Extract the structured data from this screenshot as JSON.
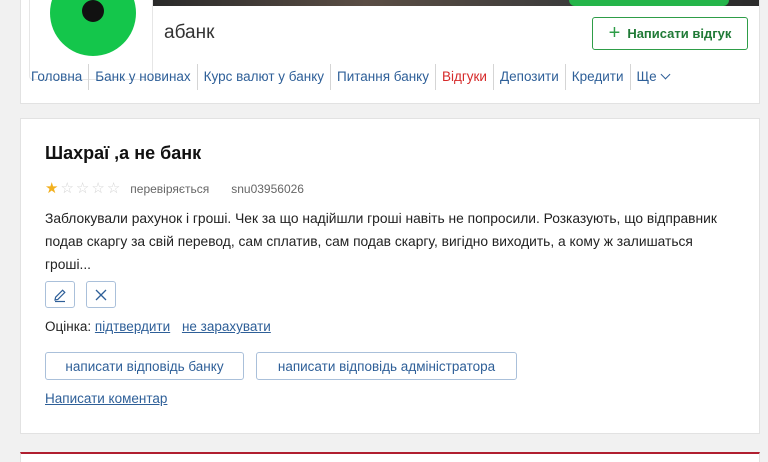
{
  "bank": {
    "name": "абанк",
    "write_review_label": "Написати відгук"
  },
  "nav": {
    "items": [
      {
        "label": "Головна"
      },
      {
        "label": "Банк у новинах"
      },
      {
        "label": "Курс валют у банку"
      },
      {
        "label": "Питання банку"
      },
      {
        "label": "Відгуки",
        "active": true
      },
      {
        "label": "Депозити"
      },
      {
        "label": "Кредити"
      },
      {
        "label": "Ще"
      }
    ]
  },
  "review": {
    "title": "Шахраї ,а не банк",
    "rating": 1,
    "rating_max": 5,
    "status": "перевіряється",
    "user_id": "snu03956026",
    "body": "Заблокували рахунок і гроші. Чек за що надійшли гроші навіть не попросили. Розказують, що відправник подав скаргу за свій перевод, сам сплатив, сам подав скаргу, вигідно виходить, а кому ж залишаться гроші...",
    "rating_label": "Оцінка:",
    "confirm_label": "підтвердити",
    "reject_label": "не зарахувати",
    "reply_bank_label": "написати відповідь банку",
    "reply_admin_label": "написати відповідь адміністратора",
    "comment_label": "Написати коментар"
  },
  "colors": {
    "accent_green": "#2e9d48",
    "link_blue": "#2e5f98",
    "active_red": "#d62a2a",
    "star": "#f2b01e"
  }
}
